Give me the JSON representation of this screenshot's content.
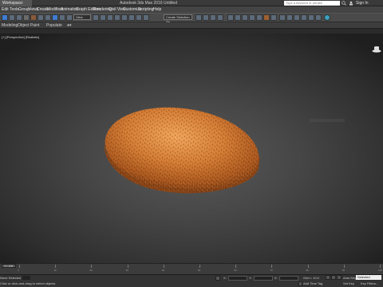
{
  "titlebar": {
    "workspace": "Workspace: Default",
    "title": "Autodesk 3ds Max 2016     Untitled",
    "search_placeholder": "Type a keyword or phrase",
    "signin": "Sign In"
  },
  "menubar": {
    "items": [
      "Edit",
      "Tools",
      "Group",
      "Views",
      "Create",
      "Modifiers",
      "Animation",
      "Graph Editors",
      "Rendering",
      "Civil View",
      "Customize",
      "Scripting",
      "Help"
    ]
  },
  "toolbar": {
    "view_dropdown": "View",
    "selection_set": "Create Selection Se"
  },
  "ribbon": {
    "tabs": [
      "Modeling",
      "Object Paint",
      "Populate"
    ]
  },
  "viewport": {
    "label": "[+] [Perspective] [Realistic]"
  },
  "timeline": {
    "ticks": [
      "0",
      "10",
      "20",
      "30",
      "40",
      "50",
      "60",
      "70",
      "80",
      "90",
      "100"
    ],
    "frame": "0 / 100"
  },
  "status": {
    "selection": "None Selected",
    "prompt": "Click or click-and-drag to select objects",
    "welcome": "Welcome to M",
    "x_label": "X:",
    "y_label": "Y:",
    "z_label": "Z:",
    "grid": "Grid = 10.0",
    "add_time_tag": "Add Time Tag",
    "auto_key": "Auto Key",
    "set_key": "Set Key",
    "key_filters": "Key Filters...",
    "selected": "Selected"
  },
  "colors": {
    "accent": "#3e7bd1",
    "viewport_bg": "#454545"
  }
}
